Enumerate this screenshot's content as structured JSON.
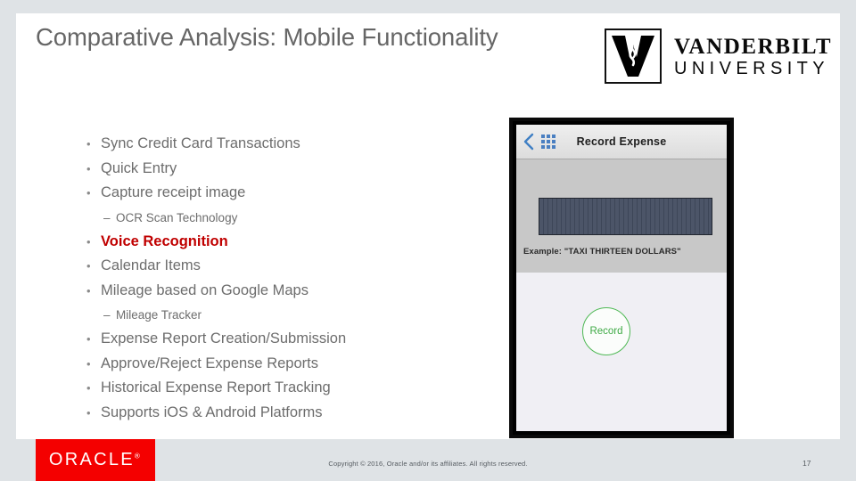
{
  "slide": {
    "title": "Comparative Analysis: Mobile Functionality",
    "page_number": "17"
  },
  "branding": {
    "vanderbilt": {
      "mark_icon": "vanderbilt-v-monogram",
      "name": "VANDERBILT",
      "subtitle": "UNIVERSITY"
    },
    "oracle": {
      "wordmark": "ORACLE",
      "trademark": "®",
      "box_color": "#f40000"
    }
  },
  "bullets": [
    {
      "level": 1,
      "marker": "•",
      "text": "Sync Credit Card Transactions",
      "emphasis": false
    },
    {
      "level": 1,
      "marker": "•",
      "text": "Quick Entry",
      "emphasis": false
    },
    {
      "level": 1,
      "marker": "•",
      "text": "Capture receipt image",
      "emphasis": false
    },
    {
      "level": 2,
      "marker": "–",
      "text": "OCR Scan Technology",
      "emphasis": false
    },
    {
      "level": 1,
      "marker": "•",
      "text": "Voice Recognition",
      "emphasis": true
    },
    {
      "level": 1,
      "marker": "•",
      "text": "Calendar Items",
      "emphasis": false
    },
    {
      "level": 1,
      "marker": "•",
      "text": "Mileage based on Google Maps",
      "emphasis": false
    },
    {
      "level": 2,
      "marker": "–",
      "text": "Mileage Tracker",
      "emphasis": false
    },
    {
      "level": 1,
      "marker": "•",
      "text": "Expense Report Creation/Submission",
      "emphasis": false
    },
    {
      "level": 1,
      "marker": "•",
      "text": "Approve/Reject Expense Reports",
      "emphasis": false
    },
    {
      "level": 1,
      "marker": "•",
      "text": "Historical Expense Report Tracking",
      "emphasis": false
    },
    {
      "level": 1,
      "marker": "•",
      "text": "Supports iOS & Android Platforms",
      "emphasis": false
    }
  ],
  "emphasis_color": "#c00000",
  "phone": {
    "app_bar": {
      "back_icon": "chevron-left-icon",
      "grid_icon": "grid-menu-icon",
      "title": "Record Expense"
    },
    "example_label": "Example: \"TAXI THIRTEEN DOLLARS\"",
    "record_button_label": "Record",
    "record_button_color": "#4fb955",
    "waveform_color": "#4c5568"
  },
  "footer": {
    "copyright": "Copyright © 2016, Oracle and/or its affiliates. All rights reserved."
  }
}
